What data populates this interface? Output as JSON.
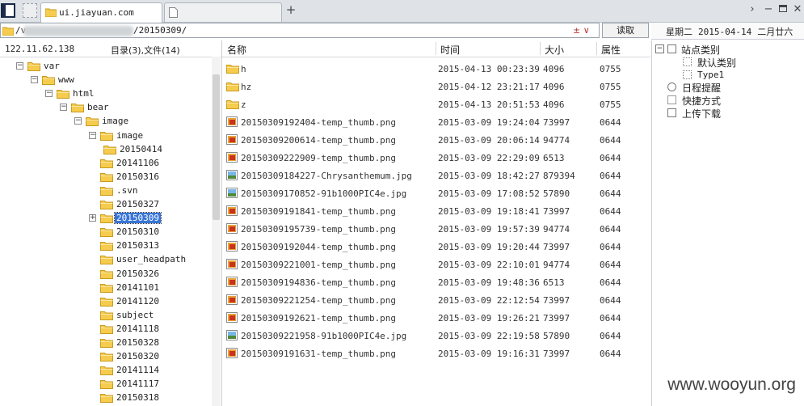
{
  "tabs": [
    {
      "label": "ui.jiayuan.com",
      "active": true
    },
    {
      "label": "",
      "active": false
    }
  ],
  "new_tab_label": "+",
  "address": {
    "path_prefix": "/v",
    "path_suffix": "/20150309/",
    "dropdown": "±  ∨"
  },
  "read_button": "读取",
  "date": {
    "weekday": "星期二",
    "date": "2015-04-14",
    "lunar": "二月廿六"
  },
  "left_header": {
    "ip": "122.11.62.138",
    "count": "目录(3),文件(14)"
  },
  "tree": [
    {
      "label": "var",
      "level": 1,
      "exp": "−"
    },
    {
      "label": "www",
      "level": 2,
      "exp": "−"
    },
    {
      "label": "html",
      "level": 3,
      "exp": "−"
    },
    {
      "label": "bear",
      "level": 4,
      "exp": "−"
    },
    {
      "label": "image",
      "level": 5,
      "exp": "−"
    },
    {
      "label": "image",
      "level": 6,
      "exp": "−"
    },
    {
      "label": "20150414",
      "level": 7,
      "exp": ""
    },
    {
      "label": "20141106",
      "level": 6,
      "exp": ""
    },
    {
      "label": "20150316",
      "level": 6,
      "exp": ""
    },
    {
      "label": ".svn",
      "level": 6,
      "exp": ""
    },
    {
      "label": "20150327",
      "level": 6,
      "exp": ""
    },
    {
      "label": "20150309",
      "level": 6,
      "exp": "+",
      "selected": true
    },
    {
      "label": "20150310",
      "level": 6,
      "exp": ""
    },
    {
      "label": "20150313",
      "level": 6,
      "exp": ""
    },
    {
      "label": "user_headpath",
      "level": 6,
      "exp": ""
    },
    {
      "label": "20150326",
      "level": 6,
      "exp": ""
    },
    {
      "label": "20141101",
      "level": 6,
      "exp": ""
    },
    {
      "label": "20141120",
      "level": 6,
      "exp": ""
    },
    {
      "label": "subject",
      "level": 6,
      "exp": ""
    },
    {
      "label": "20141118",
      "level": 6,
      "exp": ""
    },
    {
      "label": "20150328",
      "level": 6,
      "exp": ""
    },
    {
      "label": "20150320",
      "level": 6,
      "exp": ""
    },
    {
      "label": "20141114",
      "level": 6,
      "exp": ""
    },
    {
      "label": "20141117",
      "level": 6,
      "exp": ""
    },
    {
      "label": "20150318",
      "level": 6,
      "exp": ""
    }
  ],
  "columns": {
    "name": "名称",
    "time": "时间",
    "size": "大小",
    "attr": "属性"
  },
  "files": [
    {
      "name": "h",
      "time": "2015-04-13 00:23:39",
      "size": "4096",
      "attr": "0755",
      "type": "folder"
    },
    {
      "name": "hz",
      "time": "2015-04-12 23:21:17",
      "size": "4096",
      "attr": "0755",
      "type": "folder"
    },
    {
      "name": "z",
      "time": "2015-04-13 20:51:53",
      "size": "4096",
      "attr": "0755",
      "type": "folder"
    },
    {
      "name": "20150309192404-temp_thumb.png",
      "time": "2015-03-09 19:24:04",
      "size": "73997",
      "attr": "0644",
      "type": "png"
    },
    {
      "name": "20150309200614-temp_thumb.png",
      "time": "2015-03-09 20:06:14",
      "size": "94774",
      "attr": "0644",
      "type": "png"
    },
    {
      "name": "20150309222909-temp_thumb.png",
      "time": "2015-03-09 22:29:09",
      "size": "6513",
      "attr": "0644",
      "type": "png"
    },
    {
      "name": "20150309184227-Chrysanthemum.jpg",
      "time": "2015-03-09 18:42:27",
      "size": "879394",
      "attr": "0644",
      "type": "jpg"
    },
    {
      "name": "20150309170852-91b1000PIC4e.jpg",
      "time": "2015-03-09 17:08:52",
      "size": "57890",
      "attr": "0644",
      "type": "jpg"
    },
    {
      "name": "20150309191841-temp_thumb.png",
      "time": "2015-03-09 19:18:41",
      "size": "73997",
      "attr": "0644",
      "type": "png"
    },
    {
      "name": "20150309195739-temp_thumb.png",
      "time": "2015-03-09 19:57:39",
      "size": "94774",
      "attr": "0644",
      "type": "png"
    },
    {
      "name": "20150309192044-temp_thumb.png",
      "time": "2015-03-09 19:20:44",
      "size": "73997",
      "attr": "0644",
      "type": "png"
    },
    {
      "name": "20150309221001-temp_thumb.png",
      "time": "2015-03-09 22:10:01",
      "size": "94774",
      "attr": "0644",
      "type": "png"
    },
    {
      "name": "20150309194836-temp_thumb.png",
      "time": "2015-03-09 19:48:36",
      "size": "6513",
      "attr": "0644",
      "type": "png"
    },
    {
      "name": "20150309221254-temp_thumb.png",
      "time": "2015-03-09 22:12:54",
      "size": "73997",
      "attr": "0644",
      "type": "png"
    },
    {
      "name": "20150309192621-temp_thumb.png",
      "time": "2015-03-09 19:26:21",
      "size": "73997",
      "attr": "0644",
      "type": "png"
    },
    {
      "name": "20150309221958-91b1000PIC4e.jpg",
      "time": "2015-03-09 22:19:58",
      "size": "57890",
      "attr": "0644",
      "type": "jpg"
    },
    {
      "name": "20150309191631-temp_thumb.png",
      "time": "2015-03-09 19:16:31",
      "size": "73997",
      "attr": "0644",
      "type": "png"
    }
  ],
  "right_panel": {
    "site_category": "站点类别",
    "default_category": "默认类别",
    "type1": "Type1",
    "schedule": "日程提醒",
    "shortcut": "快捷方式",
    "upload_download": "上传下载"
  },
  "watermark": "www.wooyun.org",
  "colors": {
    "selection": "#3875d7",
    "folder": "#f5cc4e",
    "folder_edge": "#c99a1c"
  }
}
